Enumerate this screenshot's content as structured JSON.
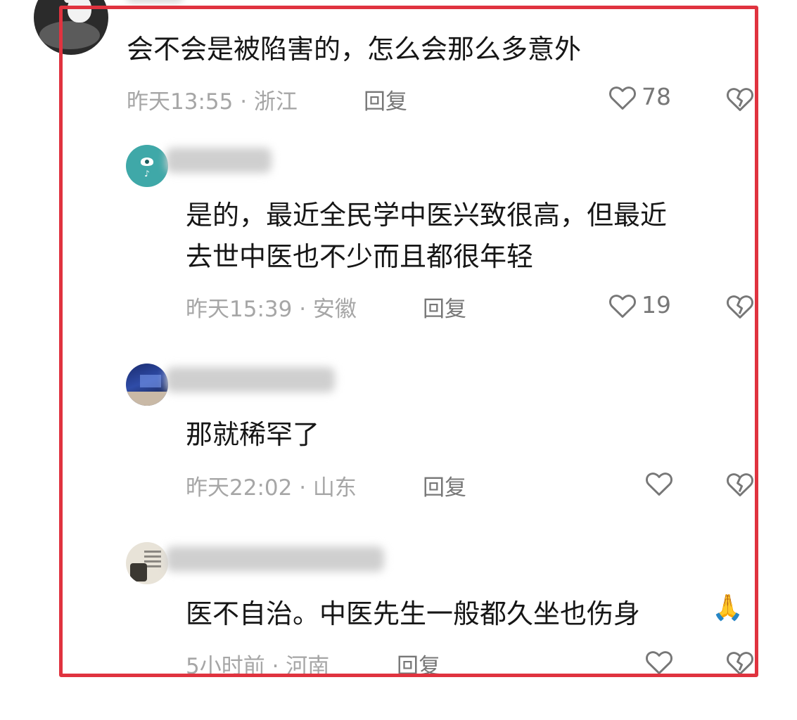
{
  "comments": [
    {
      "text_lines": [
        "会不会是被陷害的，怎么会那么多意外"
      ],
      "meta": "昨天13:55 · 浙江",
      "reply_label": "回复",
      "likes": "78"
    },
    {
      "text_lines": [
        "是的，最近全民学中医兴致很高，但最近",
        "去世中医也不少而且都很年轻"
      ],
      "meta": "昨天15:39 · 安徽",
      "reply_label": "回复",
      "likes": "19"
    },
    {
      "text_lines": [
        "那就稀罕了"
      ],
      "meta": "昨天22:02 · 山东",
      "reply_label": "回复",
      "likes": ""
    },
    {
      "text_lines": [
        "医不自治。中医先生一般都久坐也伤身"
      ],
      "emoji": "🙏",
      "meta": "5小时前 · 河南",
      "reply_label": "回复",
      "likes": ""
    }
  ],
  "icons": {
    "like": "heart-outline-icon",
    "dislike": "broken-heart-icon"
  },
  "colors": {
    "frame": "#e0333f",
    "meta": "#a6a6a6",
    "icon": "#777777"
  }
}
